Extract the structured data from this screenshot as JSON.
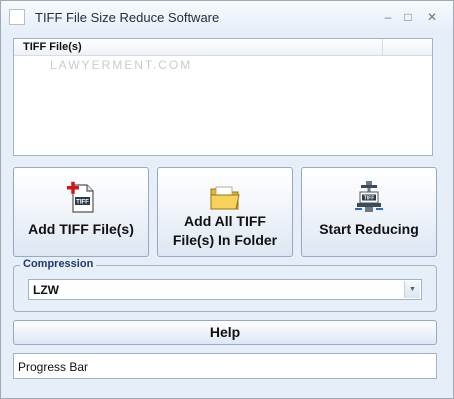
{
  "window": {
    "title": "TIFF File Size Reduce Software",
    "controls": {
      "minimize": "–",
      "maximize": "□",
      "close": "✕"
    }
  },
  "file_list": {
    "column_header": "TIFF File(s)",
    "watermark": "LAWYERMENT.COM"
  },
  "buttons": {
    "add_files": "Add TIFF File(s)",
    "add_folder_line1": "Add All TIFF",
    "add_folder_line2": "File(s) In Folder",
    "start": "Start Reducing",
    "help": "Help"
  },
  "compression": {
    "label": "Compression",
    "selected": "LZW",
    "arrow": "▼"
  },
  "progress": {
    "text": "Progress Bar"
  },
  "icons": {
    "window": "app-icon",
    "add_files": "tiff-file-add-icon",
    "add_folder": "folder-open-icon",
    "start": "compress-vise-icon"
  },
  "colors": {
    "background": "#e6eef8",
    "border": "#9eb3cc",
    "accent_red": "#d01818",
    "folder_yellow": "#f3c843"
  }
}
